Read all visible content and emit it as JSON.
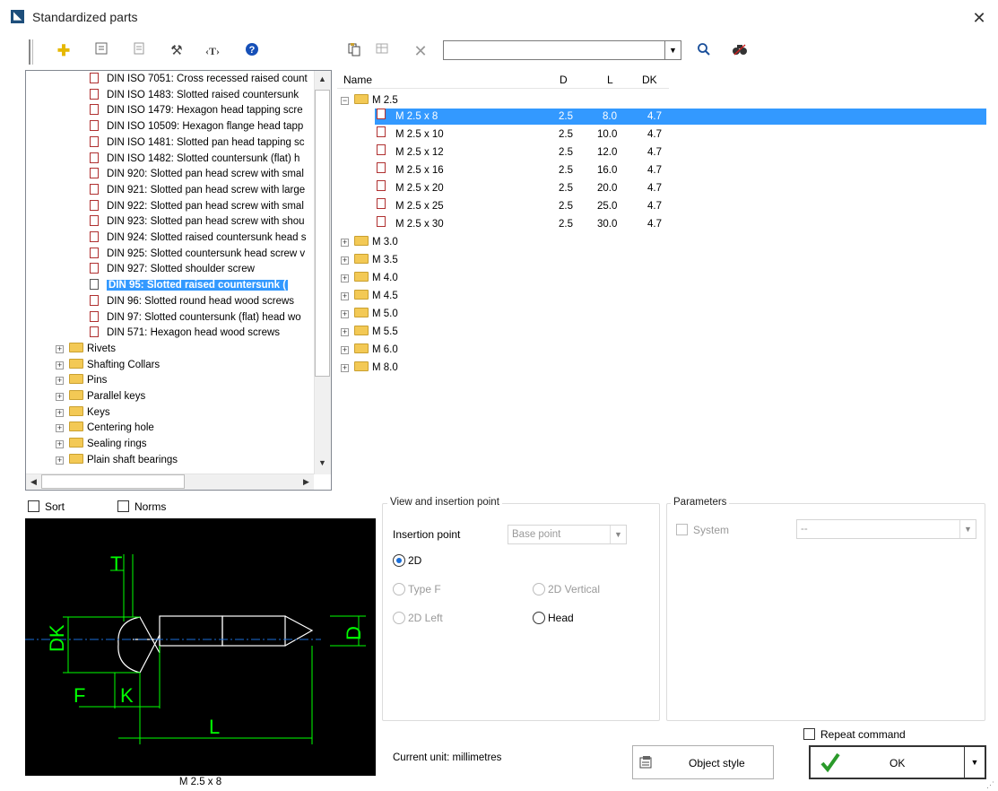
{
  "window": {
    "title": "Standardized parts",
    "close_symbol": "✕"
  },
  "toolbar": {
    "search_value": "",
    "search_placeholder": ""
  },
  "tree": {
    "items": [
      {
        "label": "DIN ISO 7051: Cross recessed raised count",
        "kind": "doc"
      },
      {
        "label": "DIN ISO 1483: Slotted raised countersunk",
        "kind": "doc"
      },
      {
        "label": "DIN ISO 1479: Hexagon head tapping scre",
        "kind": "doc"
      },
      {
        "label": "DIN ISO 10509: Hexagon flange head tapp",
        "kind": "doc"
      },
      {
        "label": "DIN ISO 1481: Slotted pan head tapping sc",
        "kind": "doc"
      },
      {
        "label": "DIN ISO 1482: Slotted countersunk (flat) h",
        "kind": "doc"
      },
      {
        "label": "DIN 920: Slotted pan head screw with smal",
        "kind": "doc"
      },
      {
        "label": "DIN 921: Slotted pan head screw with large",
        "kind": "doc"
      },
      {
        "label": "DIN 922: Slotted pan head screw with smal",
        "kind": "doc"
      },
      {
        "label": "DIN 923: Slotted pan head screw with shou",
        "kind": "doc"
      },
      {
        "label": "DIN 924: Slotted raised countersunk head s",
        "kind": "doc"
      },
      {
        "label": "DIN 925: Slotted countersunk head screw v",
        "kind": "doc"
      },
      {
        "label": "DIN 927: Slotted shoulder screw",
        "kind": "doc"
      },
      {
        "label": "DIN 95: Slotted raised countersunk (",
        "kind": "selected"
      },
      {
        "label": "DIN 96: Slotted round head wood screws",
        "kind": "doc"
      },
      {
        "label": "DIN 97: Slotted countersunk (flat) head wo",
        "kind": "doc"
      },
      {
        "label": "DIN 571: Hexagon head wood screws",
        "kind": "doc"
      },
      {
        "label": "Rivets",
        "kind": "folder"
      },
      {
        "label": "Shafting Collars",
        "kind": "folder"
      },
      {
        "label": "Pins",
        "kind": "folder"
      },
      {
        "label": "Parallel keys",
        "kind": "folder"
      },
      {
        "label": "Keys",
        "kind": "folder"
      },
      {
        "label": "Centering hole",
        "kind": "folder"
      },
      {
        "label": "Sealing rings",
        "kind": "folder"
      },
      {
        "label": "Plain shaft bearings",
        "kind": "folder"
      }
    ]
  },
  "list": {
    "columns": {
      "name": "Name",
      "d": "D",
      "l": "L",
      "dk": "DK"
    },
    "groups": [
      {
        "label": "M 2.5",
        "expanded": true
      },
      {
        "label": "M 3.0"
      },
      {
        "label": "M 3.5"
      },
      {
        "label": "M 4.0"
      },
      {
        "label": "M 4.5"
      },
      {
        "label": "M 5.0"
      },
      {
        "label": "M 5.5"
      },
      {
        "label": "M 6.0"
      },
      {
        "label": "M 8.0"
      }
    ],
    "rows": [
      {
        "name": "M 2.5 x 8",
        "d": "2.5",
        "l": "8.0",
        "dk": "4.7"
      },
      {
        "name": "M 2.5 x 10",
        "d": "2.5",
        "l": "10.0",
        "dk": "4.7"
      },
      {
        "name": "M 2.5 x 12",
        "d": "2.5",
        "l": "12.0",
        "dk": "4.7"
      },
      {
        "name": "M 2.5 x 16",
        "d": "2.5",
        "l": "16.0",
        "dk": "4.7"
      },
      {
        "name": "M 2.5 x 20",
        "d": "2.5",
        "l": "20.0",
        "dk": "4.7"
      },
      {
        "name": "M 2.5 x 25",
        "d": "2.5",
        "l": "25.0",
        "dk": "4.7"
      },
      {
        "name": "M 2.5 x 30",
        "d": "2.5",
        "l": "30.0",
        "dk": "4.7"
      }
    ]
  },
  "options": {
    "sort": "Sort",
    "norms": "Norms"
  },
  "preview": {
    "caption": "M 2.5 x 8",
    "dims": {
      "dk": "DK",
      "d": "D",
      "l": "L",
      "f": "F",
      "k": "K",
      "t": "T"
    }
  },
  "view_group": {
    "title": "View and insertion point",
    "insertion_label": "Insertion point",
    "insertion_value": "Base point",
    "radio_2d": "2D",
    "radio_typef": "Type F",
    "radio_2dvertical": "2D Vertical",
    "radio_2dleft": "2D Left",
    "radio_head": "Head"
  },
  "params_group": {
    "title": "Parameters",
    "system_label": "System",
    "system_value": "--"
  },
  "footer": {
    "unit_text": "Current unit: millimetres",
    "object_style": "Object style",
    "repeat": "Repeat command",
    "ok": "OK"
  },
  "colors": {
    "selection": "#3399ff",
    "drawing": "#00ff00"
  }
}
